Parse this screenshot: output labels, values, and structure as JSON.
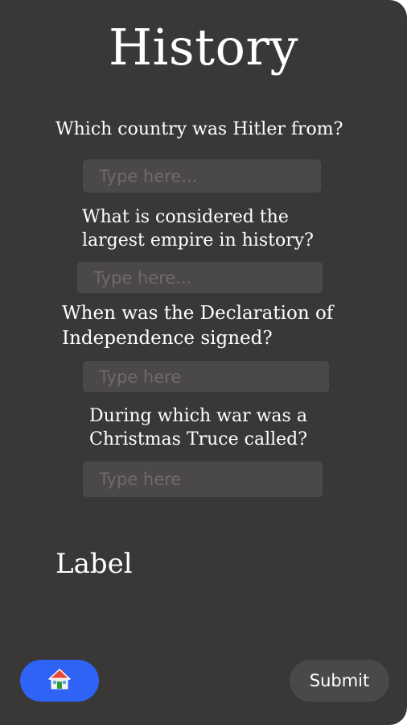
{
  "page": {
    "title": "History"
  },
  "questions": [
    {
      "text": "Which country was Hitler from?",
      "placeholder": "Type here..."
    },
    {
      "text": "What is considered the\nlargest empire in history?",
      "placeholder": "Type here..."
    },
    {
      "text": "When was the Declaration of\nIndependence signed?",
      "placeholder": "Type here"
    },
    {
      "text": "During which war was a\nChristmas Truce called?",
      "placeholder": "Type here"
    }
  ],
  "result": {
    "label": "Label"
  },
  "footer": {
    "home_icon": "house-icon",
    "submit_label": "Submit"
  },
  "colors": {
    "background": "#3a3737",
    "input_background": "#4b4848",
    "home_button": "#2e63f6",
    "text": "#ffffff"
  }
}
